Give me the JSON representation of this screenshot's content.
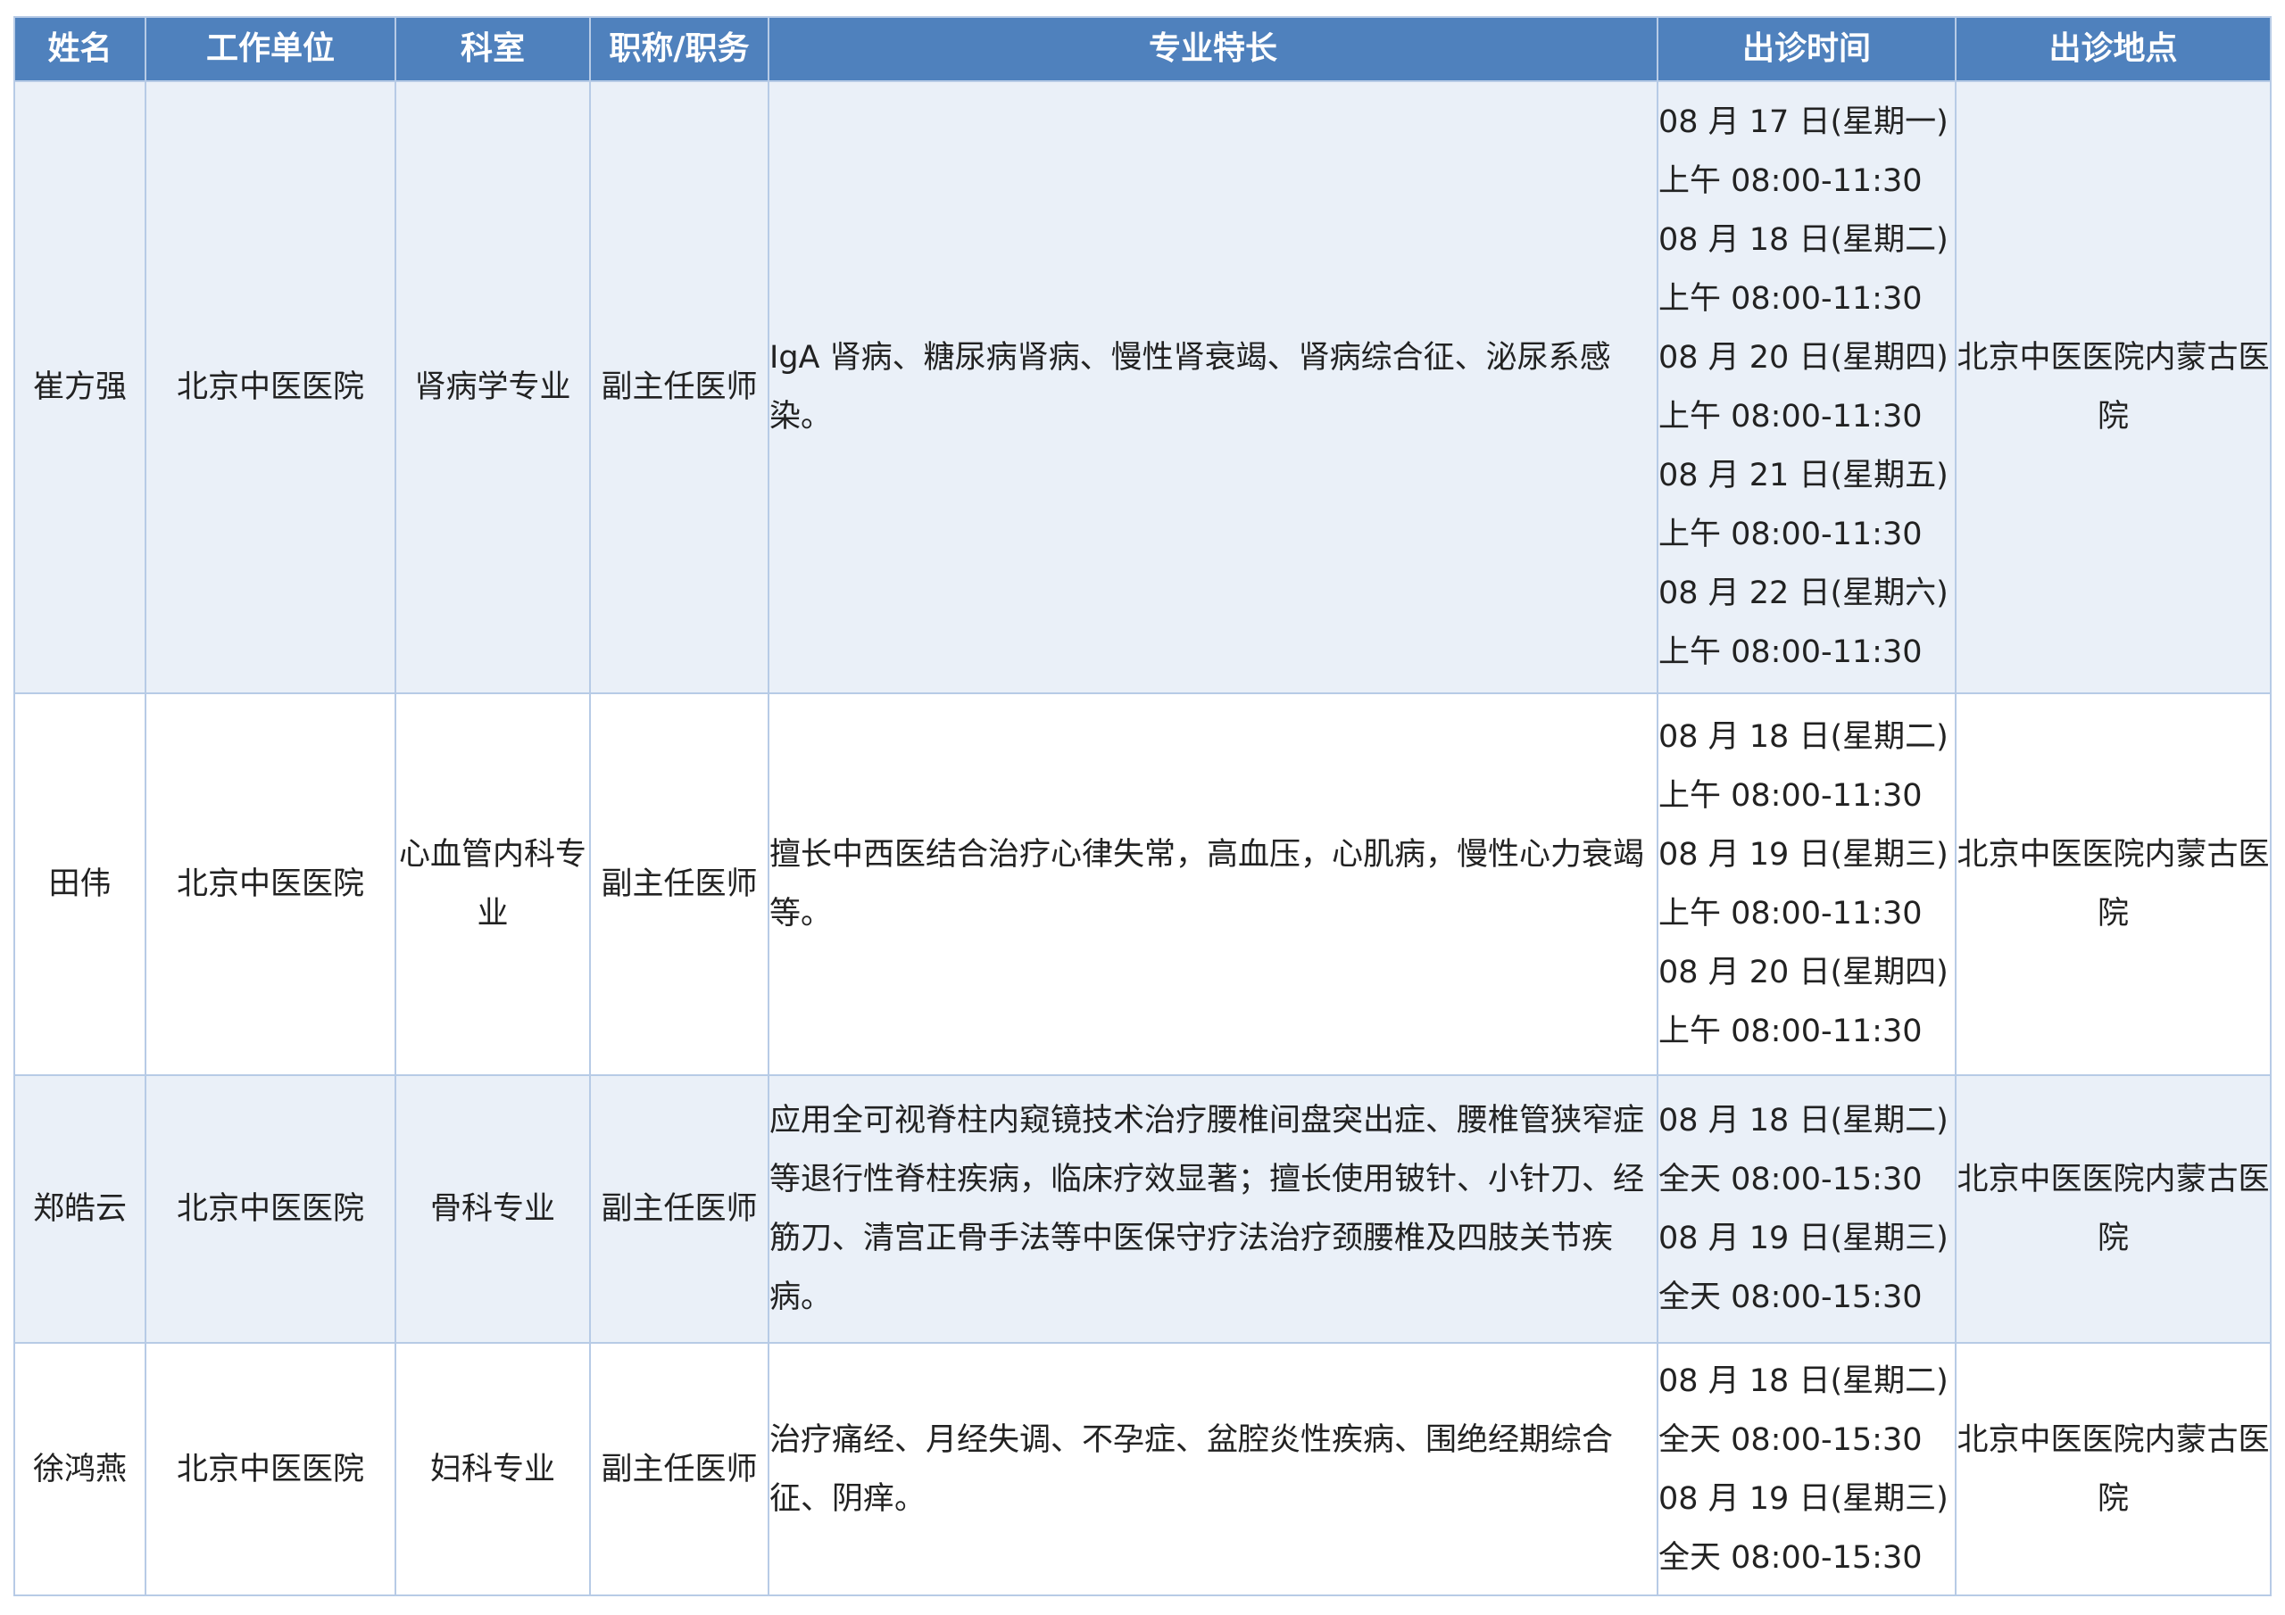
{
  "table": {
    "headers": [
      "姓名",
      "工作单位",
      "科室",
      "职称/职务",
      "专业特长",
      "出诊时间",
      "出诊地点"
    ],
    "rows": [
      {
        "name": "崔方强",
        "unit": "北京中医医院",
        "dept": "肾病学专业",
        "title": "副主任医师",
        "specialty": "IgA 肾病、糖尿病肾病、慢性肾衰竭、肾病综合征、泌尿系感染。",
        "times": [
          "08 月 17 日(星期一)",
          "上午 08:00-11:30",
          "08 月 18 日(星期二)",
          "上午 08:00-11:30",
          "08 月 20 日(星期四)",
          "上午 08:00-11:30",
          "08 月 21 日(星期五)",
          "上午 08:00-11:30",
          "08 月 22 日(星期六)",
          "上午 08:00-11:30"
        ],
        "location": "北京中医医院内蒙古医院"
      },
      {
        "name": "田伟",
        "unit": "北京中医医院",
        "dept": "心血管内科专业",
        "title": "副主任医师",
        "specialty": "擅长中西医结合治疗心律失常，高血压，心肌病，慢性心力衰竭等。",
        "times": [
          "08 月 18 日(星期二)",
          "上午 08:00-11:30",
          "08 月 19 日(星期三)",
          "上午 08:00-11:30",
          "08 月 20 日(星期四)",
          "上午 08:00-11:30"
        ],
        "location": "北京中医医院内蒙古医院"
      },
      {
        "name": "郑皓云",
        "unit": "北京中医医院",
        "dept": "骨科专业",
        "title": "副主任医师",
        "specialty": "应用全可视脊柱内窥镜技术治疗腰椎间盘突出症、腰椎管狭窄症等退行性脊柱疾病，临床疗效显著；擅长使用铍针、小针刀、经筋刀、清宫正骨手法等中医保守疗法治疗颈腰椎及四肢关节疾病。",
        "times": [
          "08 月 18 日(星期二)",
          "全天 08:00-15:30",
          "08 月 19 日(星期三)",
          "全天 08:00-15:30"
        ],
        "location": "北京中医医院内蒙古医院"
      },
      {
        "name": "徐鸿燕",
        "unit": "北京中医医院",
        "dept": "妇科专业",
        "title": "副主任医师",
        "specialty": "治疗痛经、月经失调、不孕症、盆腔炎性疾病、围绝经期综合征、阴痒。",
        "times": [
          "08 月 18 日(星期二)",
          "全天 08:00-15:30",
          "08 月 19 日(星期三)",
          "全天 08:00-15:30"
        ],
        "location": "北京中医医院内蒙古医院"
      }
    ]
  }
}
